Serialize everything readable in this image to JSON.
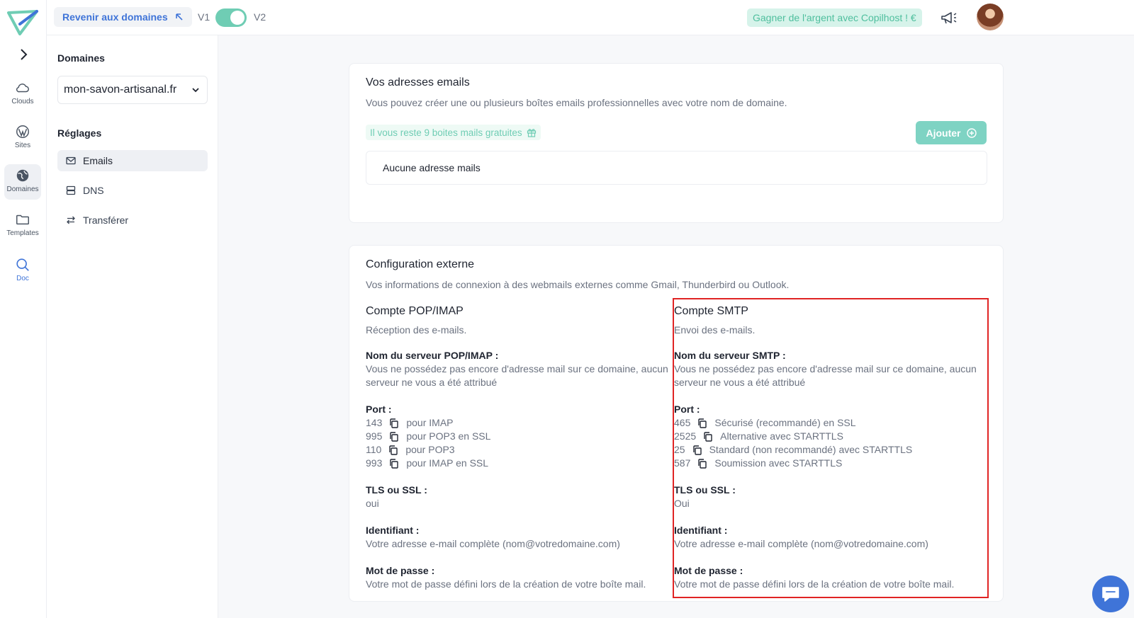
{
  "topbar": {
    "back_label": "Revenir aux domaines",
    "v1": "V1",
    "v2": "V2",
    "earn_label": "Gagner de l'argent avec Copilhost ! €"
  },
  "rail": {
    "items": [
      {
        "label": "Clouds",
        "icon": "cloud-icon"
      },
      {
        "label": "Sites",
        "icon": "wordpress-icon"
      },
      {
        "label": "Domaines",
        "icon": "globe-icon"
      },
      {
        "label": "Templates",
        "icon": "folder-icon"
      },
      {
        "label": "Doc",
        "icon": "search-icon"
      }
    ]
  },
  "sidebar": {
    "domains_heading": "Domaines",
    "selected_domain": "mon-savon-artisanal.fr",
    "settings_heading": "Réglages",
    "items": [
      {
        "label": "Emails",
        "icon": "mail-icon"
      },
      {
        "label": "DNS",
        "icon": "server-icon"
      },
      {
        "label": "Transférer",
        "icon": "transfer-icon"
      }
    ]
  },
  "emails": {
    "title": "Vos adresses emails",
    "subtitle": "Vous pouvez créer une ou plusieurs boîtes emails professionnelles avec votre nom de domaine.",
    "free_badge": "Il vous reste 9 boites mails gratuites",
    "add_label": "Ajouter",
    "empty_text": "Aucune adresse mails"
  },
  "config": {
    "title": "Configuration externe",
    "subtitle": "Vos informations de connexion à des webmails externes comme Gmail, Thunderbird ou Outlook.",
    "pop": {
      "title": "Compte POP/IMAP",
      "subtitle": "Réception des e-mails.",
      "server_label": "Nom du serveur POP/IMAP :",
      "server_value": "Vous ne possédez pas encore d'adresse mail sur ce domaine, aucun serveur ne vous a été attribué",
      "port_label": "Port :",
      "ports": [
        {
          "num": "143",
          "desc": "pour IMAP"
        },
        {
          "num": "995",
          "desc": "pour POP3 en SSL"
        },
        {
          "num": "110",
          "desc": "pour POP3"
        },
        {
          "num": "993",
          "desc": "pour IMAP en SSL"
        }
      ],
      "tls_label": "TLS ou SSL :",
      "tls_value": "oui",
      "id_label": "Identifiant :",
      "id_value": "Votre adresse e-mail complète (nom@votredomaine.com)",
      "pw_label": "Mot de passe :",
      "pw_value": "Votre mot de passe défini lors de la création de votre boîte mail."
    },
    "smtp": {
      "title": "Compte SMTP",
      "subtitle": "Envoi des e-mails.",
      "server_label": "Nom du serveur SMTP :",
      "server_value": "Vous ne possédez pas encore d'adresse mail sur ce domaine, aucun serveur ne vous a été attribué",
      "port_label": "Port :",
      "ports": [
        {
          "num": "465",
          "desc": "Sécurisé (recommandé) en SSL"
        },
        {
          "num": "2525",
          "desc": "Alternative avec STARTTLS"
        },
        {
          "num": "25",
          "desc": "Standard (non recommandé) avec STARTTLS"
        },
        {
          "num": "587",
          "desc": "Soumission avec STARTTLS"
        }
      ],
      "tls_label": "TLS ou SSL :",
      "tls_value": "Oui",
      "id_label": "Identifiant :",
      "id_value": "Votre adresse e-mail complète (nom@votredomaine.com)",
      "pw_label": "Mot de passe :",
      "pw_value": "Votre mot de passe défini lors de la création de votre boîte mail."
    }
  },
  "colors": {
    "accent": "#3f74d8",
    "teal": "#6fcdb4",
    "highlight": "#e02424"
  }
}
